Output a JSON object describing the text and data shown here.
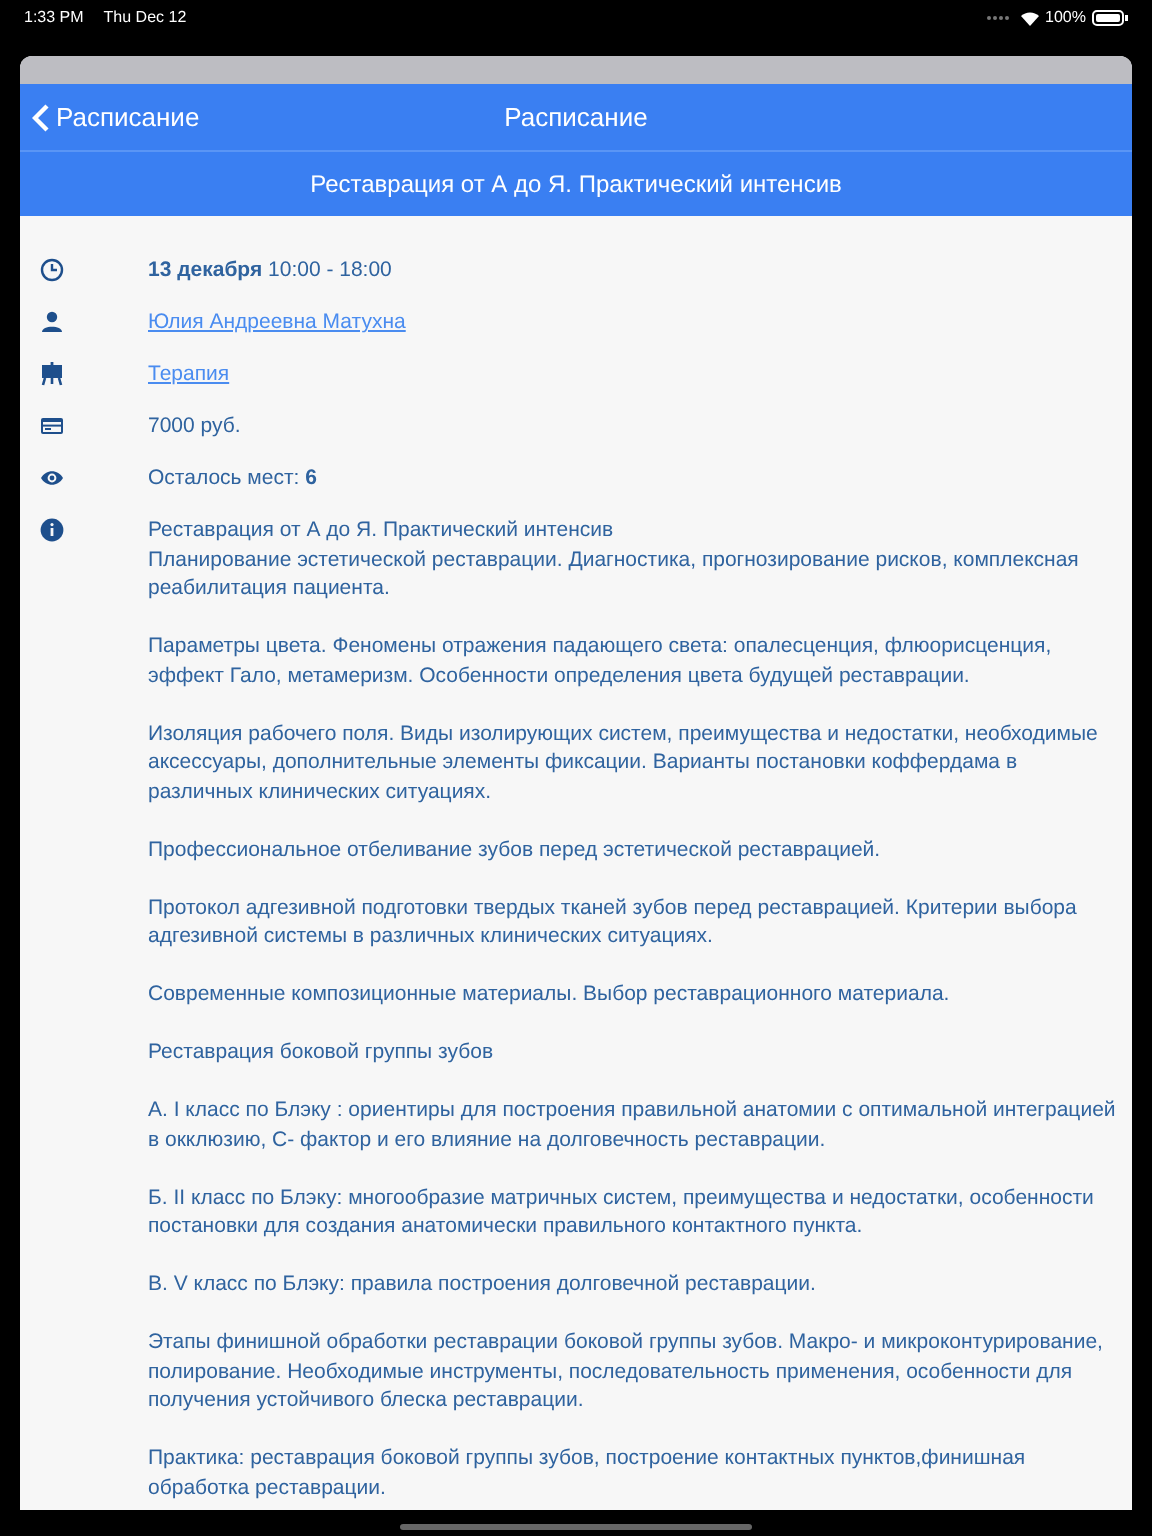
{
  "status_bar": {
    "time": "1:33 PM",
    "date": "Thu Dec 12",
    "battery": "100%"
  },
  "nav": {
    "back_label": "Расписание",
    "title": "Расписание"
  },
  "subtitle": "Реставрация от А до Я. Практический интенсив",
  "rows": [
    {
      "kind": "time",
      "text": "**13 декабря** 10:00 - 18:00"
    },
    {
      "kind": "link",
      "text": "Юлия Андреевна Матухна"
    },
    {
      "kind": "link",
      "text": "Терапия"
    },
    {
      "kind": "text",
      "text": "7000 руб."
    },
    {
      "kind": "text",
      "text": "Осталось мест: **6**"
    },
    {
      "kind": "description",
      "paragraphs": [
        "Реставрация от А до Я. Практический интенсив\nПланирование эстетической реставрации. Диагностика, прогнозирование рисков, комплексная реабилитация пациента.",
        "Параметры цвета. Феномены отражения падающего света: опалесценция, флюорисценция, эффект Гало, метамеризм. Особенности определения цвета будущей реставрации.",
        "Изоляция рабочего поля. Виды изолирующих систем, преимущества и недостатки, необходимые аксессуары, дополнительные элементы фиксации. Варианты постановки коффердама в различных клинических ситуациях.",
        "Профессиональное отбеливание зубов перед эстетической реставрацией.",
        "Протокол адгезивной подготовки твердых тканей зубов перед реставрацией. Критерии выбора адгезивной системы в различных клинических ситуациях.",
        "Современные композиционные материалы. Выбор реставрационного материала.",
        "Реставрация боковой группы зубов",
        "А. I класс по Блэку : ориентиры для построения правильной анатомии с оптимальной интеграцией в окклюзию, С- фактор и его влияние на долговечность реставрации.",
        "Б. II класс по Блэку: многообразие матричных систем, преимущества и недостатки, особенности постановки для создания анатомически правильного контактного пункта.",
        "В. V класс по Блэку: правила построения долговечной реставрации.",
        "Этапы финишной обработки реставрации боковой группы зубов. Макро- и микроконтурирование, полирование. Необходимые инструменты, последовательность применения, особенности для получения устойчивого блеска реставрации.",
        "Практика: реставрация боковой группы зубов, построение контактных пунктов,финишная обработка реставрации."
      ]
    }
  ]
}
